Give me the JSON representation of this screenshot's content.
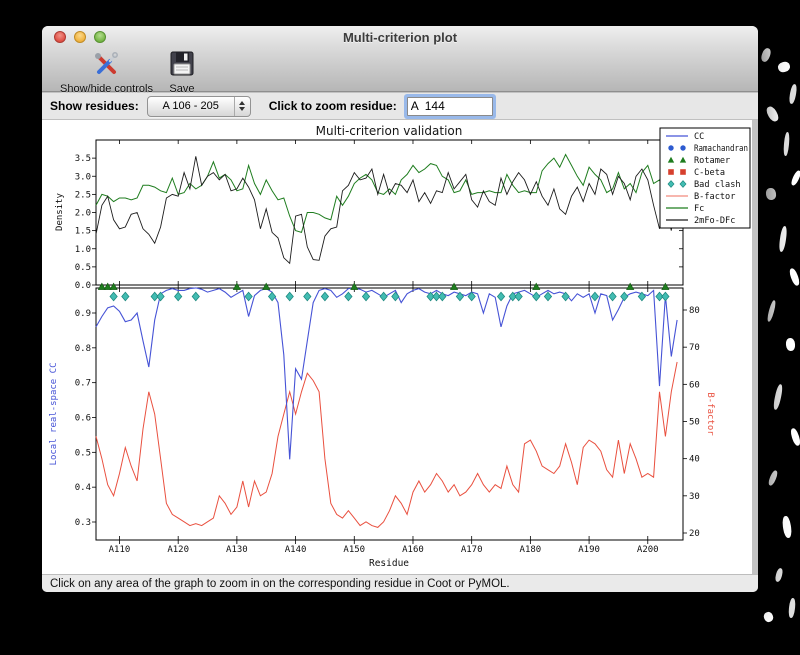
{
  "window": {
    "title": "Multi-criterion plot"
  },
  "toolbar": {
    "show_hide_label": "Show/hide controls",
    "save_label": "Save"
  },
  "controls": {
    "show_residues_label": "Show residues:",
    "show_residues_value": "A 106 - 205",
    "zoom_residue_label": "Click to zoom residue:",
    "zoom_residue_value": "A  144"
  },
  "status_bar": {
    "text": "Click on any area of the graph to zoom in on the corresponding residue in Coot or PyMOL."
  },
  "chart_data": {
    "type": "line",
    "title": "Multi-criterion validation",
    "xlabel": "Residue",
    "x_start": 106,
    "x_range": [
      106,
      206
    ],
    "x_ticks": [
      110,
      120,
      130,
      140,
      150,
      160,
      170,
      180,
      190,
      200
    ],
    "x_tick_labels": [
      "A110",
      "A120",
      "A130",
      "A140",
      "A150",
      "A160",
      "A170",
      "A180",
      "A190",
      "A200"
    ],
    "colors": {
      "cc": "#4653d6",
      "bfactor": "#e9503f",
      "fc": "#1f7d1f",
      "map": "#1c1c1c",
      "rotamer": "#1e7c1e",
      "badclash_fill": "#42bcb2",
      "badclash_stroke": "#1f8a80",
      "ramachandran": "#2d5bd0",
      "cbeta": "#d6402e",
      "bfactor_legend": "#f28b7d"
    },
    "panels": [
      {
        "ylabel": "Density",
        "ylim": [
          0,
          4.0
        ],
        "ytick_labels": [
          "0.0",
          "0.5",
          "1.0",
          "1.5",
          "2.0",
          "2.5",
          "3.0",
          "3.5"
        ],
        "yticks": [
          0,
          0.5,
          1.0,
          1.5,
          2.0,
          2.5,
          3.0,
          3.5
        ],
        "series": [
          {
            "name": "Fc",
            "color_key": "fc",
            "values": [
              2.2,
              2.5,
              2.45,
              2.3,
              2.4,
              2.4,
              2.35,
              2.4,
              2.75,
              2.75,
              2.7,
              2.6,
              2.55,
              2.95,
              2.5,
              2.55,
              2.8,
              2.65,
              2.75,
              3.0,
              3.4,
              2.95,
              3.05,
              2.9,
              2.6,
              2.65,
              3.3,
              2.8,
              2.5,
              2.9,
              2.6,
              2.35,
              2.4,
              1.9,
              1.5,
              1.45,
              2.0,
              2.0,
              1.95,
              1.85,
              1.8,
              2.45,
              2.2,
              2.45,
              2.8,
              2.95,
              3.05,
              2.9,
              2.55,
              2.5,
              2.65,
              2.5,
              2.9,
              3.05,
              3.3,
              3.1,
              3.2,
              3.35,
              3.3,
              3.0,
              2.9,
              2.55,
              2.6,
              2.9,
              2.5,
              2.55,
              2.55,
              2.6,
              2.55,
              2.55,
              3.05,
              2.75,
              2.55,
              2.6,
              2.55,
              2.55,
              3.15,
              3.35,
              3.5,
              3.25,
              3.6,
              3.3,
              3.0,
              2.75,
              3.25,
              3.05,
              2.9,
              2.55,
              2.65,
              3.1,
              2.65,
              2.8,
              2.55,
              3.1,
              3.3,
              2.8,
              2.9,
              2.55,
              3.2,
              3.3
            ]
          },
          {
            "name": "2mFo-DFc",
            "color_key": "map",
            "values": [
              1.4,
              2.2,
              2.45,
              1.8,
              1.55,
              1.6,
              1.95,
              2.0,
              1.55,
              1.4,
              1.15,
              1.6,
              2.4,
              2.5,
              2.45,
              3.1,
              2.65,
              3.55,
              2.75,
              3.0,
              3.1,
              2.9,
              3.05,
              2.6,
              2.65,
              2.95,
              2.7,
              2.35,
              1.55,
              2.1,
              1.45,
              1.3,
              0.75,
              0.6,
              1.9,
              1.95,
              1.05,
              0.7,
              0.68,
              1.35,
              1.55,
              1.6,
              2.6,
              2.75,
              3.1,
              2.9,
              2.95,
              3.2,
              2.5,
              3.05,
              2.5,
              2.8,
              2.75,
              2.55,
              2.9,
              2.3,
              2.55,
              2.25,
              2.6,
              2.55,
              3.1,
              2.65,
              2.85,
              3.05,
              2.35,
              2.15,
              2.6,
              2.3,
              2.2,
              2.95,
              2.5,
              2.85,
              3.1,
              2.9,
              2.5,
              2.85,
              2.45,
              2.2,
              2.65,
              2.1,
              1.95,
              2.45,
              2.7,
              2.3,
              2.8,
              2.5,
              3.2,
              3.05,
              2.5,
              3.0,
              2.8,
              2.35,
              3.0,
              3.2,
              2.9,
              2.2,
              1.55,
              2.25,
              1.5,
              3.0
            ]
          }
        ]
      },
      {
        "ylabel_left": "Local real-space CC",
        "ylabel_right": "B-factor",
        "yticks_left": [
          0.3,
          0.4,
          0.5,
          0.6,
          0.7,
          0.8,
          0.9
        ],
        "ytick_labels_left": [
          "0.3",
          "0.4",
          "0.5",
          "0.6",
          "0.7",
          "0.8",
          "0.9"
        ],
        "yticks_right": [
          20,
          30,
          40,
          50,
          60,
          70,
          80
        ],
        "ytick_labels_right": [
          "20",
          "30",
          "40",
          "50",
          "60",
          "70",
          "80"
        ],
        "series": [
          {
            "name": "CC",
            "axis": "left",
            "color_key": "cc",
            "values": [
              0.86,
              0.89,
              0.915,
              0.92,
              0.905,
              0.875,
              0.88,
              0.9,
              0.82,
              0.745,
              0.88,
              0.955,
              0.965,
              0.97,
              0.965,
              0.965,
              0.97,
              0.972,
              0.968,
              0.96,
              0.965,
              0.97,
              0.96,
              0.945,
              0.955,
              0.965,
              0.89,
              0.95,
              0.965,
              0.97,
              0.96,
              0.93,
              0.78,
              0.48,
              0.74,
              0.71,
              0.82,
              0.93,
              0.965,
              0.97,
              0.965,
              0.945,
              0.955,
              0.97,
              0.972,
              0.968,
              0.96,
              0.965,
              0.955,
              0.945,
              0.955,
              0.965,
              0.93,
              0.955,
              0.965,
              0.97,
              0.96,
              0.955,
              0.965,
              0.955,
              0.95,
              0.96,
              0.955,
              0.95,
              0.96,
              0.955,
              0.9,
              0.955,
              0.945,
              0.86,
              0.92,
              0.955,
              0.96,
              0.965,
              0.955,
              0.945,
              0.955,
              0.965,
              0.955,
              0.96,
              0.955,
              0.935,
              0.955,
              0.945,
              0.955,
              0.9,
              0.955,
              0.95,
              0.88,
              0.91,
              0.945,
              0.955,
              0.96,
              0.955,
              0.95,
              0.965,
              0.69,
              0.95,
              0.775,
              0.88
            ]
          },
          {
            "name": "B-factor",
            "axis": "right",
            "color_key": "bfactor",
            "values": [
              46,
              40,
              33,
              30,
              36,
              43,
              38,
              34,
              48,
              58,
              52,
              40,
              28,
              25,
              24,
              23,
              22,
              22.5,
              22,
              23,
              24,
              30,
              28,
              25,
              27,
              34,
              27,
              34,
              30,
              31,
              36,
              46,
              52,
              58,
              52,
              58,
              63,
              61,
              58,
              40,
              28,
              25,
              24,
              26,
              24,
              22,
              23,
              22,
              21.5,
              23,
              26,
              30,
              28,
              25,
              31,
              34,
              31,
              33,
              36,
              34,
              31,
              33,
              30,
              31,
              33,
              36,
              33,
              31,
              33,
              32,
              38,
              33,
              31,
              44,
              45,
              42,
              38,
              37,
              36,
              38,
              44,
              39,
              33,
              43,
              45,
              44,
              42,
              37,
              35,
              45,
              36,
              44,
              40,
              35,
              36,
              35,
              58,
              46,
              58,
              66
            ]
          }
        ],
        "markers": [
          {
            "name": "Rotamer",
            "shape": "triangle",
            "residues": [
              107,
              108,
              109,
              130,
              135,
              150,
              167,
              181,
              197,
              203
            ]
          },
          {
            "name": "Bad clash",
            "shape": "diamond",
            "residues": [
              109,
              111,
              116,
              117,
              120,
              123,
              132,
              136,
              139,
              142,
              145,
              149,
              152,
              155,
              157,
              163,
              164,
              165,
              168,
              170,
              175,
              177,
              178,
              181,
              183,
              186,
              191,
              194,
              196,
              199,
              202,
              203
            ]
          }
        ]
      }
    ],
    "legend": {
      "position": "upper right",
      "entries": [
        {
          "label": "CC",
          "type": "line",
          "color_key": "cc"
        },
        {
          "label": "Ramachandran",
          "type": "circles",
          "color_key": "ramachandran"
        },
        {
          "label": "Rotamer",
          "type": "triangles",
          "color_key": "rotamer"
        },
        {
          "label": "C-beta",
          "type": "squares",
          "color_key": "cbeta"
        },
        {
          "label": "Bad clash",
          "type": "diamonds",
          "color_key": "badclash_fill"
        },
        {
          "label": "B-factor",
          "type": "line",
          "color_key": "bfactor_legend"
        },
        {
          "label": "Fc",
          "type": "line",
          "color_key": "fc"
        },
        {
          "label": "2mFo-DFc",
          "type": "line",
          "color_key": "map"
        }
      ]
    }
  }
}
